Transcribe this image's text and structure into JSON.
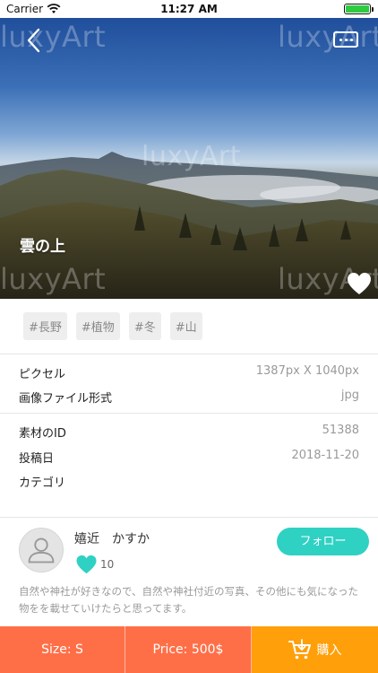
{
  "status_bar": {
    "carrier": "Carrier",
    "time": "11:27 AM",
    "battery_level": 1.0
  },
  "hero": {
    "watermark": "luxyArt",
    "title": "雲の上",
    "icons": {
      "back": "chevron-left-icon",
      "more": "more-dots-icon",
      "favorite": "heart-icon"
    }
  },
  "tags": [
    "#長野",
    "#植物",
    "#冬",
    "#山"
  ],
  "info": {
    "pixels_label": "ピクセル",
    "pixels_value": "1387px X 1040px",
    "format_label": "画像ファイル形式",
    "format_value": "jpg",
    "id_label": "素材のID",
    "id_value": "51388",
    "date_label": "投稿日",
    "date_value": "2018-11-20",
    "category_label": "カテゴリ"
  },
  "author": {
    "name": "嬉近　かすか",
    "likes": "10",
    "follow_label": "フォロー",
    "bio": "自然や神社が好きなので、自然や神社付近の写真、その他にも気になった物をを載せていけたらと思ってます。"
  },
  "bottom_bar": {
    "size": "Size: S",
    "price": "Price: 500$",
    "buy": "購入"
  },
  "colors": {
    "accent_teal": "#2fd1c3",
    "orange": "#ff6f47",
    "buy_orange": "#ff9f0a"
  }
}
